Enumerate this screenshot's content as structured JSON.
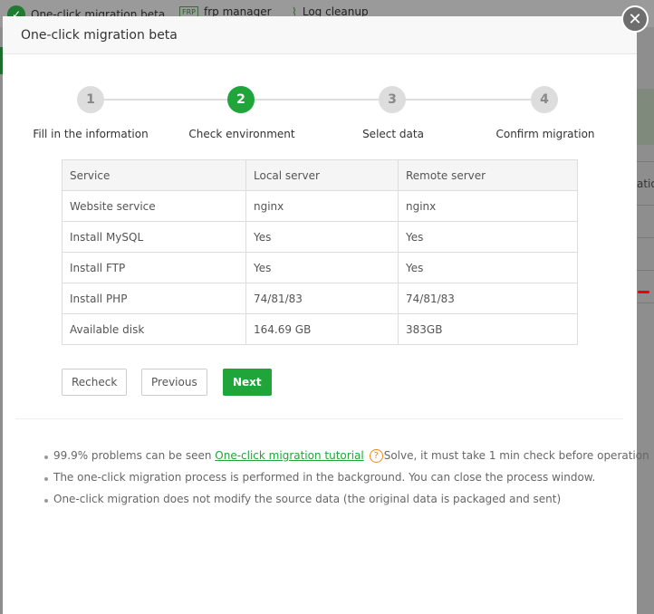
{
  "background": {
    "tabs": [
      {
        "label": "One-click migration beta",
        "icon": "check-circle-icon"
      },
      {
        "label": "frp manager",
        "icon": "frp-icon",
        "icon_text": "FRP"
      },
      {
        "label": "Log cleanup",
        "icon": "broom-icon"
      }
    ],
    "partial_text": "ation"
  },
  "dialog": {
    "title": "One-click migration beta",
    "close_symbol": "✕",
    "steps": [
      {
        "number": "1",
        "label": "Fill in the information"
      },
      {
        "number": "2",
        "label": "Check environment",
        "active": true
      },
      {
        "number": "3",
        "label": "Select data"
      },
      {
        "number": "4",
        "label": "Confirm migration"
      }
    ],
    "table": {
      "headers": [
        "Service",
        "Local server",
        "Remote server"
      ],
      "rows": [
        [
          "Website service",
          "nginx",
          "nginx"
        ],
        [
          "Install MySQL",
          "Yes",
          "Yes"
        ],
        [
          "Install FTP",
          "Yes",
          "Yes"
        ],
        [
          "Install PHP",
          "74/81/83",
          "74/81/83"
        ],
        [
          "Available disk",
          "164.69 GB",
          "383GB"
        ]
      ]
    },
    "buttons": {
      "recheck": "Recheck",
      "previous": "Previous",
      "next": "Next"
    },
    "notes": {
      "n1_prefix": "99.9% problems can be seen ",
      "n1_link": "One-click migration tutorial",
      "n1_q": "?",
      "n1_suffix": "Solve, it must take 1 min check before operation",
      "n2": "The one-click migration process is performed in the background. You can close the process window.",
      "n3": "One-click migration does not modify the source data (the original data is packaged and sent)"
    }
  },
  "colors": {
    "accent": "#20a53a",
    "help": "#f0891f"
  }
}
